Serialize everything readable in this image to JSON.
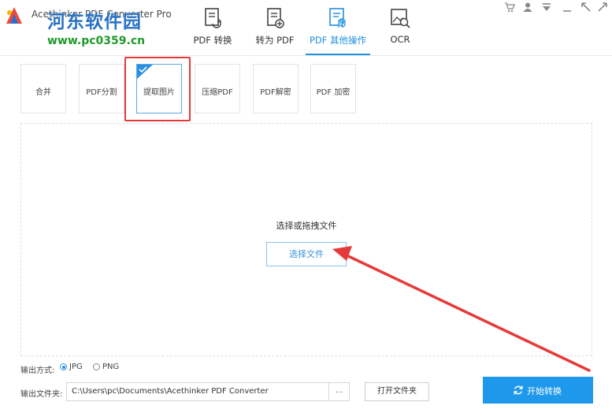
{
  "app": {
    "title": "Acethinker PDF Converter Pro",
    "watermark_name": "河东软件园",
    "watermark_url": "www.pc0359.cn"
  },
  "nav": {
    "tabs": [
      {
        "label": "PDF 转换",
        "icon": "pdf-convert-icon"
      },
      {
        "label": "转为 PDF",
        "icon": "to-pdf-icon"
      },
      {
        "label": "PDF 其他操作",
        "icon": "pdf-other-icon",
        "active": true
      },
      {
        "label": "OCR",
        "icon": "ocr-icon"
      }
    ]
  },
  "window_controls": [
    "cart-icon",
    "user-icon",
    "menu-icon",
    "minimize-icon",
    "close-icon"
  ],
  "tools": [
    {
      "label": "合并"
    },
    {
      "label": "PDF分割"
    },
    {
      "label": "提取图片",
      "selected": true
    },
    {
      "label": "压缩PDF"
    },
    {
      "label": "PDF解密"
    },
    {
      "label": "PDF 加密"
    }
  ],
  "drop_zone": {
    "hint": "选择或拖拽文件",
    "select_button": "选择文件"
  },
  "output": {
    "format_label": "输出方式:",
    "formats": [
      {
        "label": "JPG",
        "checked": true
      },
      {
        "label": "PNG",
        "checked": false
      }
    ],
    "folder_label": "输出文件夹:",
    "folder_path": "C:\\Users\\pc\\Documents\\Acethinker PDF Converter",
    "browse_label": "...",
    "open_folder_button": "打开文件夹"
  },
  "start_button": "开始转换",
  "colors": {
    "accent": "#1e98ea",
    "annotation_red": "#e63a3a",
    "watermark_blue": "#2a73c4",
    "watermark_green": "#1f9a2a"
  }
}
